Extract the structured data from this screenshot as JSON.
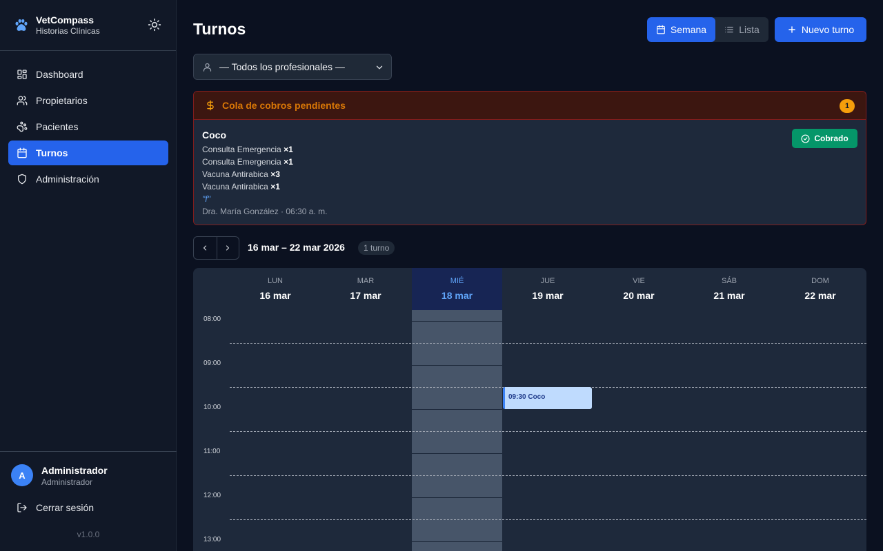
{
  "brand": {
    "name": "VetCompass",
    "subtitle": "Historias Clínicas"
  },
  "sidebar": {
    "items": [
      {
        "label": "Dashboard",
        "icon": "dashboard-icon",
        "active": false
      },
      {
        "label": "Propietarios",
        "icon": "users-icon",
        "active": false
      },
      {
        "label": "Pacientes",
        "icon": "paw-icon",
        "active": false
      },
      {
        "label": "Turnos",
        "icon": "calendar-icon",
        "active": true
      },
      {
        "label": "Administración",
        "icon": "shield-icon",
        "active": false
      }
    ]
  },
  "user": {
    "initial": "A",
    "name": "Administrador",
    "role": "Administrador",
    "logout_label": "Cerrar sesión",
    "version": "v1.0.0"
  },
  "header": {
    "title": "Turnos",
    "view_week": "Semana",
    "view_list": "Lista",
    "new_label": "Nuevo turno"
  },
  "filter": {
    "professional": "— Todos los profesionales —"
  },
  "queue": {
    "title": "Cola de cobros pendientes",
    "count": "1",
    "patient": "Coco",
    "items": [
      {
        "name": "Consulta Emergencia",
        "qty": "×1"
      },
      {
        "name": "Consulta Emergencia",
        "qty": "×1"
      },
      {
        "name": "Vacuna Antirabica",
        "qty": "×3"
      },
      {
        "name": "Vacuna Antirabica",
        "qty": "×1"
      }
    ],
    "note": "\"f\"",
    "meta": "Dra. María González · 06:30 a. m.",
    "paid_label": "Cobrado"
  },
  "week": {
    "range": "16 mar – 22 mar 2026",
    "badge": "1 turno"
  },
  "calendar": {
    "days": [
      {
        "dow": "LUN",
        "date": "16 mar"
      },
      {
        "dow": "MAR",
        "date": "17 mar"
      },
      {
        "dow": "MIÉ",
        "date": "18 mar",
        "today": true
      },
      {
        "dow": "JUE",
        "date": "19 mar"
      },
      {
        "dow": "VIE",
        "date": "20 mar"
      },
      {
        "dow": "SÁB",
        "date": "21 mar"
      },
      {
        "dow": "DOM",
        "date": "22 mar"
      }
    ],
    "hours": [
      "08:00",
      "09:00",
      "10:00",
      "11:00",
      "12:00",
      "13:00"
    ],
    "event": {
      "label": "09:30 Coco",
      "day": "JUE",
      "start": "09:30"
    }
  },
  "colors": {
    "accent": "#2563eb",
    "success": "#059669",
    "warning": "#f59e0b"
  }
}
